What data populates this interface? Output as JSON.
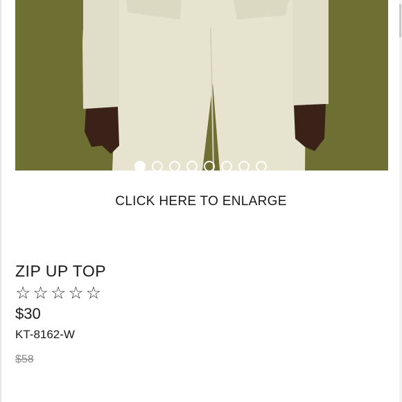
{
  "gallery": {
    "image_count": 8,
    "active_index": 0,
    "colors": {
      "backdrop": "#6d6f33",
      "garment": "#e2dfca",
      "skin": "#3a2218"
    }
  },
  "enlarge_label": "CLICK HERE TO ENLARGE",
  "product": {
    "title": "ZIP UP TOP",
    "rating": {
      "value": 0,
      "max": 5,
      "star_glyph": "☆"
    },
    "price": "$30",
    "sku": "KT-8162-W",
    "original_price": "$58"
  }
}
